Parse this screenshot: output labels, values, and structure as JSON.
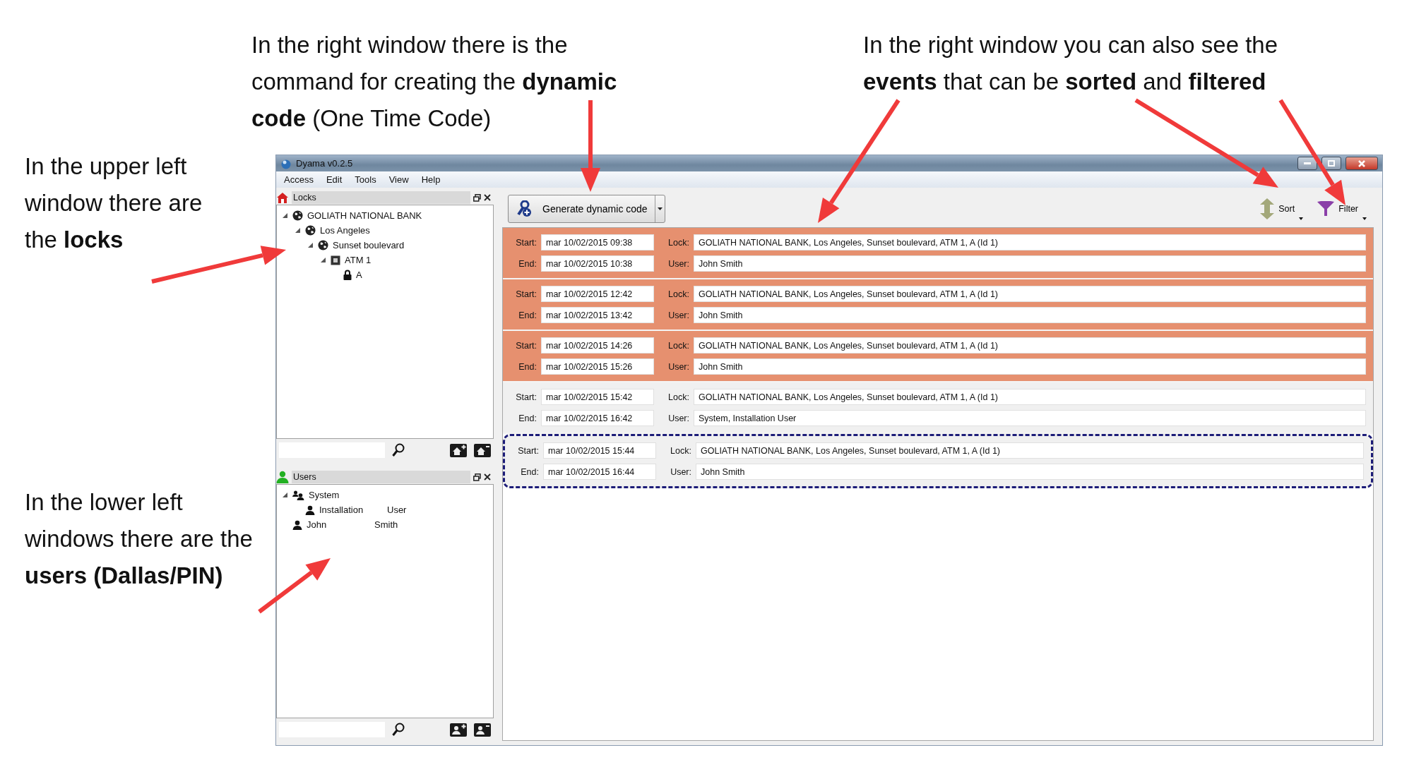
{
  "annotations": [
    {
      "text": "In the upper left window there are the **locks**"
    },
    {
      "text": "In the right window there is the command for creating the **dynamic code** (One Time Code)"
    },
    {
      "text": "In the right window you can also see the **events** that can be **sorted** and **filtered**"
    },
    {
      "text": "In the lower left windows there are the **users (Dallas/PIN)**"
    }
  ],
  "window": {
    "title": "Dyama v0.2.5"
  },
  "menu": [
    "Access",
    "Edit",
    "Tools",
    "View",
    "Help"
  ],
  "locks_panel": {
    "title": "Locks",
    "tree": [
      {
        "label": "GOLIATH NATIONAL BANK",
        "kind": "globe",
        "expanded": true,
        "children": [
          {
            "label": "Los Angeles",
            "kind": "globe",
            "expanded": true,
            "children": [
              {
                "label": "Sunset boulevard",
                "kind": "globe",
                "expanded": true,
                "children": [
                  {
                    "label": "ATM 1",
                    "kind": "atm",
                    "expanded": true,
                    "children": [
                      {
                        "label": "A",
                        "kind": "lock"
                      }
                    ]
                  }
                ]
              }
            ]
          }
        ]
      }
    ]
  },
  "users_panel": {
    "title": "Users",
    "tree": [
      {
        "first": "System",
        "kind": "group",
        "expanded": true,
        "children": [
          {
            "first": "Installation",
            "last": "User",
            "kind": "user"
          }
        ]
      },
      {
        "first": "John",
        "last": "Smith",
        "kind": "user"
      }
    ]
  },
  "toolbar": {
    "generate_button": "Generate dynamic code",
    "sort_button": "Sort",
    "filter_button": "Filter"
  },
  "events": [
    {
      "start_label": "Start:",
      "start": "mar 10/02/2015 09:38",
      "lock_label": "Lock:",
      "lock": "GOLIATH NATIONAL BANK, Los Angeles, Sunset boulevard, ATM 1, A (Id 1)",
      "end_label": "End:",
      "end": "mar 10/02/2015 10:38",
      "user_label": "User:",
      "user": "John Smith",
      "highlighted": true,
      "outlined": false
    },
    {
      "start_label": "Start:",
      "start": "mar 10/02/2015 12:42",
      "lock_label": "Lock:",
      "lock": "GOLIATH NATIONAL BANK, Los Angeles, Sunset boulevard, ATM 1, A (Id 1)",
      "end_label": "End:",
      "end": "mar 10/02/2015 13:42",
      "user_label": "User:",
      "user": "John Smith",
      "highlighted": true,
      "outlined": false
    },
    {
      "start_label": "Start:",
      "start": "mar 10/02/2015 14:26",
      "lock_label": "Lock:",
      "lock": "GOLIATH NATIONAL BANK, Los Angeles, Sunset boulevard, ATM 1, A (Id 1)",
      "end_label": "End:",
      "end": "mar 10/02/2015 15:26",
      "user_label": "User:",
      "user": "John Smith",
      "highlighted": true,
      "outlined": false
    },
    {
      "start_label": "Start:",
      "start": "mar 10/02/2015 15:42",
      "lock_label": "Lock:",
      "lock": "GOLIATH NATIONAL BANK, Los Angeles, Sunset boulevard, ATM 1, A (Id 1)",
      "end_label": "End:",
      "end": "mar 10/02/2015 16:42",
      "user_label": "User:",
      "user": "System, Installation User",
      "highlighted": false,
      "outlined": false
    },
    {
      "start_label": "Start:",
      "start": "mar 10/02/2015 15:44",
      "lock_label": "Lock:",
      "lock": "GOLIATH NATIONAL BANK, Los Angeles, Sunset boulevard, ATM 1, A (Id 1)",
      "end_label": "End:",
      "end": "mar 10/02/2015 16:44",
      "user_label": "User:",
      "user": "John Smith",
      "highlighted": false,
      "outlined": true
    }
  ]
}
